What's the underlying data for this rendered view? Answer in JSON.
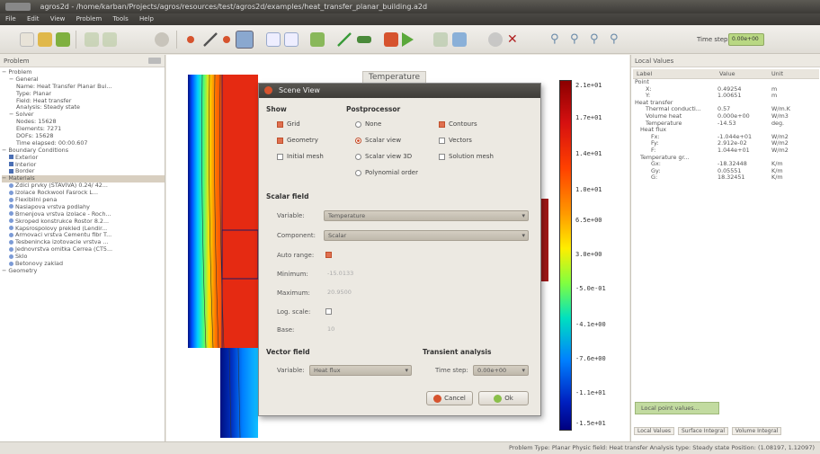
{
  "window": {
    "title": "agros2d - /home/karban/Projects/agros/resources/test/agros2d/examples/heat_transfer_planar_building.a2d"
  },
  "menu": [
    "File",
    "Edit",
    "View",
    "Problem",
    "Tools",
    "Help"
  ],
  "toolbar": {
    "time_step_label": "Time step:",
    "time_step_value": "0.00e+00"
  },
  "problem_panel": {
    "title": "Problem",
    "tree": [
      {
        "text": "Problem",
        "indent": 0
      },
      {
        "text": "General",
        "indent": 1
      },
      {
        "text": "Name: Heat Transfer Planar Bui...",
        "indent": 2
      },
      {
        "text": "Type: Planar",
        "indent": 2
      },
      {
        "text": "Field: Heat transfer",
        "indent": 2
      },
      {
        "text": "Analysis: Steady state",
        "indent": 2
      },
      {
        "text": "Solver",
        "indent": 1
      },
      {
        "text": "Nodes: 15628",
        "indent": 2
      },
      {
        "text": "Elements: 7271",
        "indent": 2
      },
      {
        "text": "DOFs: 15628",
        "indent": 2
      },
      {
        "text": "Time elapsed: 00:00.607",
        "indent": 2
      },
      {
        "text": "Boundary Conditions",
        "indent": 0
      },
      {
        "text": "Exterior",
        "indent": 1,
        "icon": "sq"
      },
      {
        "text": "Interior",
        "indent": 1,
        "icon": "sq"
      },
      {
        "text": "Border",
        "indent": 1,
        "icon": "sq"
      },
      {
        "text": "Materials",
        "indent": 0,
        "selected": true
      },
      {
        "text": "Zdici prvky (STAVIVA) 0.24/ 42...",
        "indent": 1,
        "icon": "dot"
      },
      {
        "text": "Izolace Rockwool Fasrock L...",
        "indent": 1,
        "icon": "dot"
      },
      {
        "text": "Flexibilni pena",
        "indent": 1,
        "icon": "dot"
      },
      {
        "text": "Nasiapova vrstva podlahy",
        "indent": 1,
        "icon": "dot"
      },
      {
        "text": "Brnenjova vrstva izolace - Roch...",
        "indent": 1,
        "icon": "dot"
      },
      {
        "text": "Skroped konstrukce Rostor 8.2...",
        "indent": 1,
        "icon": "dot"
      },
      {
        "text": "Kapsrospolovy prekled (Lendir...",
        "indent": 1,
        "icon": "dot"
      },
      {
        "text": "Armovaci vrstva Cementu fibr T...",
        "indent": 1,
        "icon": "dot"
      },
      {
        "text": "Tesbenincka izotovacie vrstva ...",
        "indent": 1,
        "icon": "dot"
      },
      {
        "text": "Jednovrstva omitka Cerrea (CT5...",
        "indent": 1,
        "icon": "dot"
      },
      {
        "text": "Sklo",
        "indent": 1,
        "icon": "dot"
      },
      {
        "text": "Betonovy zaklad",
        "indent": 1,
        "icon": "dot"
      },
      {
        "text": "Geometry",
        "indent": 0
      }
    ]
  },
  "viewport": {
    "title": "Temperature",
    "colorbar_labels": [
      "2.1e+01",
      "1.7e+01",
      "1.4e+01",
      "1.0e+01",
      "6.5e+00",
      "3.0e+00",
      "-5.0e-01",
      "-4.1e+00",
      "-7.6e+00",
      "-1.1e+01",
      "-1.5e+01"
    ]
  },
  "dialog": {
    "title": "Scene View",
    "show_label": "Show",
    "show_grid": "Grid",
    "show_geometry": "Geometry",
    "show_initial_mesh": "Initial mesh",
    "postprocessor_label": "Postprocessor",
    "pp_none": "None",
    "pp_scalar_view": "Scalar view",
    "pp_scalar_view_3d": "Scalar view 3D",
    "pp_polynomial_order": "Polynomial order",
    "pp_contours": "Contours",
    "pp_vectors": "Vectors",
    "pp_solution_mesh": "Solution mesh",
    "scalar_field_label": "Scalar field",
    "variable_label": "Variable:",
    "variable_value": "Temperature",
    "component_label": "Component:",
    "component_value": "Scalar",
    "auto_range_label": "Auto range:",
    "minimum_label": "Minimum:",
    "minimum_value": "-15.0133",
    "maximum_label": "Maximum:",
    "maximum_value": "20.9500",
    "log_scale_label": "Log. scale:",
    "base_label": "Base:",
    "base_value": "10",
    "vector_field_label": "Vector field",
    "vector_variable_label": "Variable:",
    "vector_variable_value": "Heat flux",
    "transient_label": "Transient analysis",
    "time_step_label": "Time step:",
    "time_step_value": "0.00e+00",
    "cancel_label": "Cancel",
    "ok_label": "Ok"
  },
  "local_values": {
    "title": "Local Values",
    "headers": [
      "Label",
      "Value",
      "Unit"
    ],
    "rows": [
      {
        "label": "Point",
        "value": "",
        "unit": "",
        "indent": 0
      },
      {
        "label": "X:",
        "value": "0.49254",
        "unit": "m",
        "indent": 2
      },
      {
        "label": "Y:",
        "value": "1.00651",
        "unit": "m",
        "indent": 2
      },
      {
        "label": "Heat transfer",
        "value": "",
        "unit": "",
        "indent": 0
      },
      {
        "label": "Thermal conducti...",
        "value": "0.57",
        "unit": "W/m.K",
        "indent": 2
      },
      {
        "label": "Volume heat",
        "value": "0.000e+00",
        "unit": "W/m3",
        "indent": 2
      },
      {
        "label": "Temperature",
        "value": "-14.53",
        "unit": "deg.",
        "indent": 2
      },
      {
        "label": "Heat flux",
        "value": "",
        "unit": "",
        "indent": 1
      },
      {
        "label": "Fx:",
        "value": "-1.044e+01",
        "unit": "W/m2",
        "indent": 3
      },
      {
        "label": "Fy:",
        "value": "2.912e-02",
        "unit": "W/m2",
        "indent": 3
      },
      {
        "label": "F:",
        "value": "1.044e+01",
        "unit": "W/m2",
        "indent": 3
      },
      {
        "label": "Temperature gr...",
        "value": "",
        "unit": "",
        "indent": 1
      },
      {
        "label": "Gx:",
        "value": "-18.32448",
        "unit": "K/m",
        "indent": 3
      },
      {
        "label": "Gy:",
        "value": "0.05551",
        "unit": "K/m",
        "indent": 3
      },
      {
        "label": "G:",
        "value": "18.32451",
        "unit": "K/m",
        "indent": 3
      }
    ],
    "point_values_button": "Local point values...",
    "tabs": [
      "Local Values",
      "Surface Integral",
      "Volume Integral"
    ]
  },
  "status": "Problem Type: Planar   Physic field: Heat transfer   Analysis type: Steady state   Position: (1.08197, 1.12097)",
  "colors": {
    "accent": "#d6532e",
    "combo_green": "#b9d883"
  }
}
